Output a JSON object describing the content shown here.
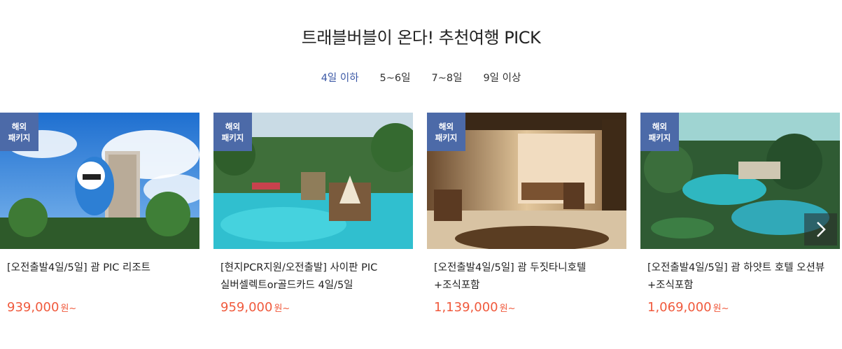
{
  "section": {
    "title": "트래블버블이 온다! 추천여행 PICK"
  },
  "tabs": [
    {
      "label": "4일 이하",
      "active": true
    },
    {
      "label": "5~6일",
      "active": false
    },
    {
      "label": "7~8일",
      "active": false
    },
    {
      "label": "9일 이상",
      "active": false
    }
  ],
  "products": [
    {
      "badge": [
        "해외",
        "패키지"
      ],
      "name": "[오전출발4일/5일] 괌 PIC 리조트",
      "price": "939,000",
      "unit": "원~"
    },
    {
      "badge": [
        "해외",
        "패키지"
      ],
      "name": "[현지PCR지원/오전출발] 사이판 PIC 실버셀렉트or골드카드 4일/5일",
      "price": "959,000",
      "unit": "원~"
    },
    {
      "badge": [
        "해외",
        "패키지"
      ],
      "name": "[오전출발4일/5일] 괌 두짓타니호텔 +조식포함",
      "price": "1,139,000",
      "unit": "원~"
    },
    {
      "badge": [
        "해외",
        "패키지"
      ],
      "name": "[오전출발4일/5일] 괌 하얏트 호텔 오션뷰+조식포함",
      "price": "1,069,000",
      "unit": "원~"
    }
  ],
  "colors": {
    "accent": "#3a57a5",
    "badge": "#4c6aa8",
    "price": "#f05a3d"
  },
  "icons": {
    "next": "chevron-right-icon"
  }
}
